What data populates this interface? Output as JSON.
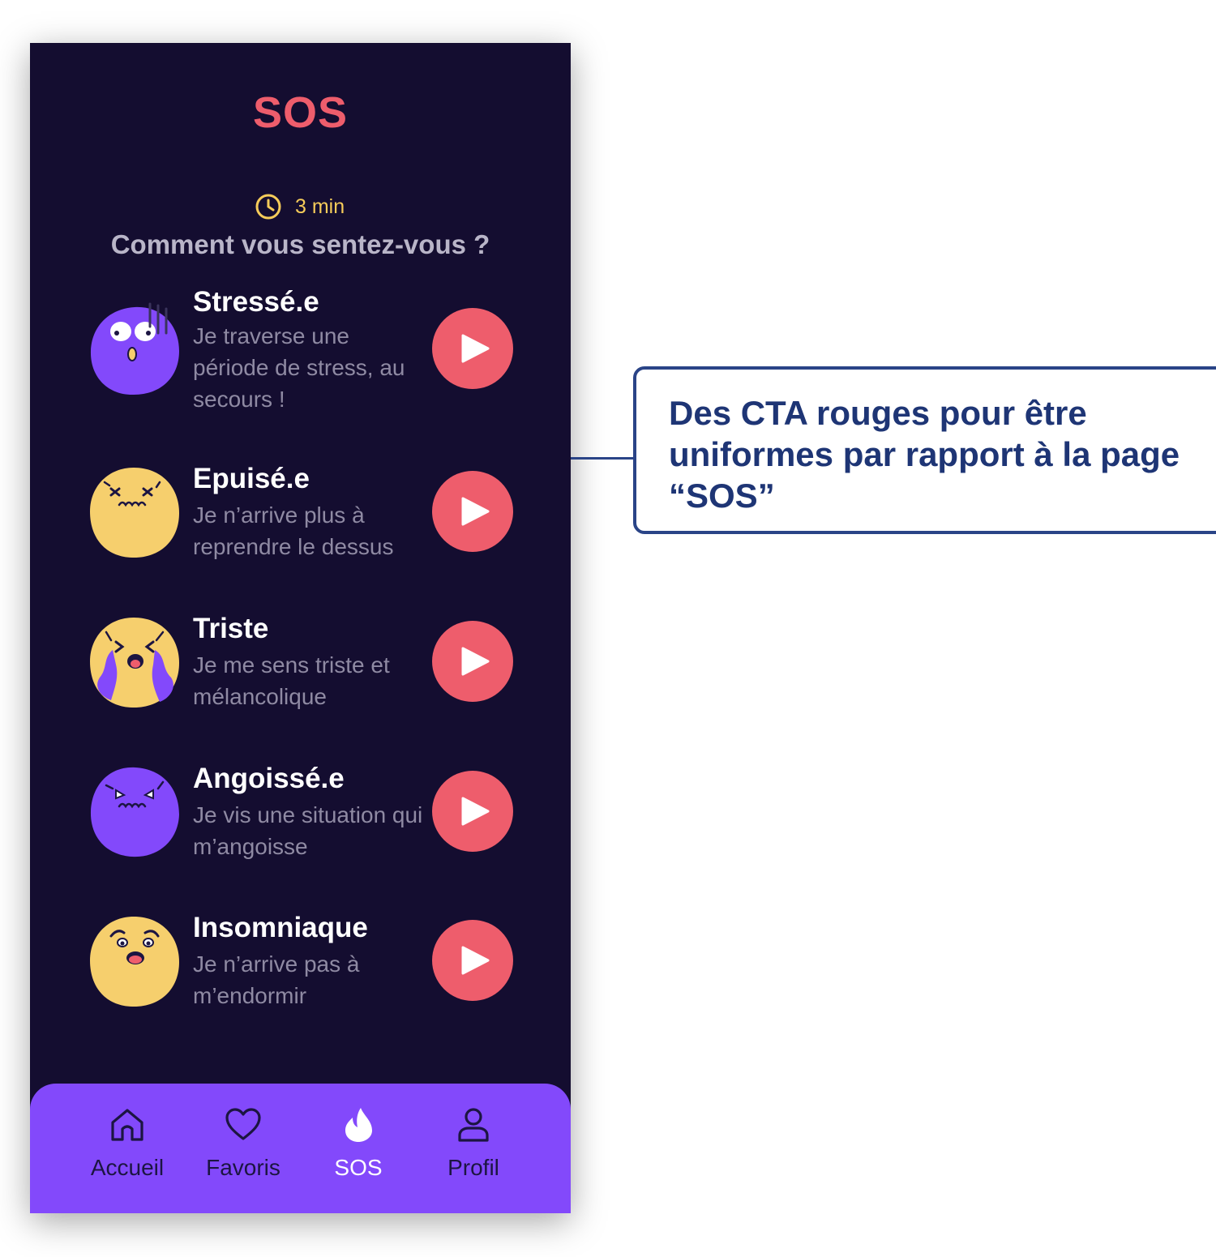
{
  "header": {
    "title": "SOS",
    "duration": "3 min",
    "question": "Comment vous sentez-vous ?"
  },
  "moods": [
    {
      "title": "Stressé.e",
      "description": "Je traverse une période de stress, au secours !",
      "face_icon": "stressed-face-icon",
      "face_color": "#8349fb"
    },
    {
      "title": "Epuisé.e",
      "description": "Je n’arrive plus à reprendre le dessus",
      "face_icon": "exhausted-face-icon",
      "face_color": "#f6cf6d"
    },
    {
      "title": "Triste",
      "description": "Je me sens triste et mélancolique",
      "face_icon": "crying-face-icon",
      "face_color": "#f6cf6d"
    },
    {
      "title": "Angoissé.e",
      "description": "Je vis une situation qui m’angoisse",
      "face_icon": "anxious-face-icon",
      "face_color": "#8349fb"
    },
    {
      "title": "Insomniaque",
      "description": "Je n’arrive pas à m’endormir",
      "face_icon": "sleepless-face-icon",
      "face_color": "#f6cf6d"
    }
  ],
  "tabbar": {
    "tabs": [
      {
        "label": "Accueil",
        "icon": "home-icon"
      },
      {
        "label": "Favoris",
        "icon": "heart-icon"
      },
      {
        "label": "SOS",
        "icon": "flame-icon",
        "active": true
      },
      {
        "label": "Profil",
        "icon": "user-icon"
      }
    ]
  },
  "annotation": {
    "text": "Des CTA rouges pour être uniformes par rapport à la page “SOS”"
  },
  "colors": {
    "background": "#140d30",
    "accent_red": "#ee5d6c",
    "tabbar": "#8349fb",
    "clock": "#f6cc5a",
    "annotation": "#1e3575"
  }
}
